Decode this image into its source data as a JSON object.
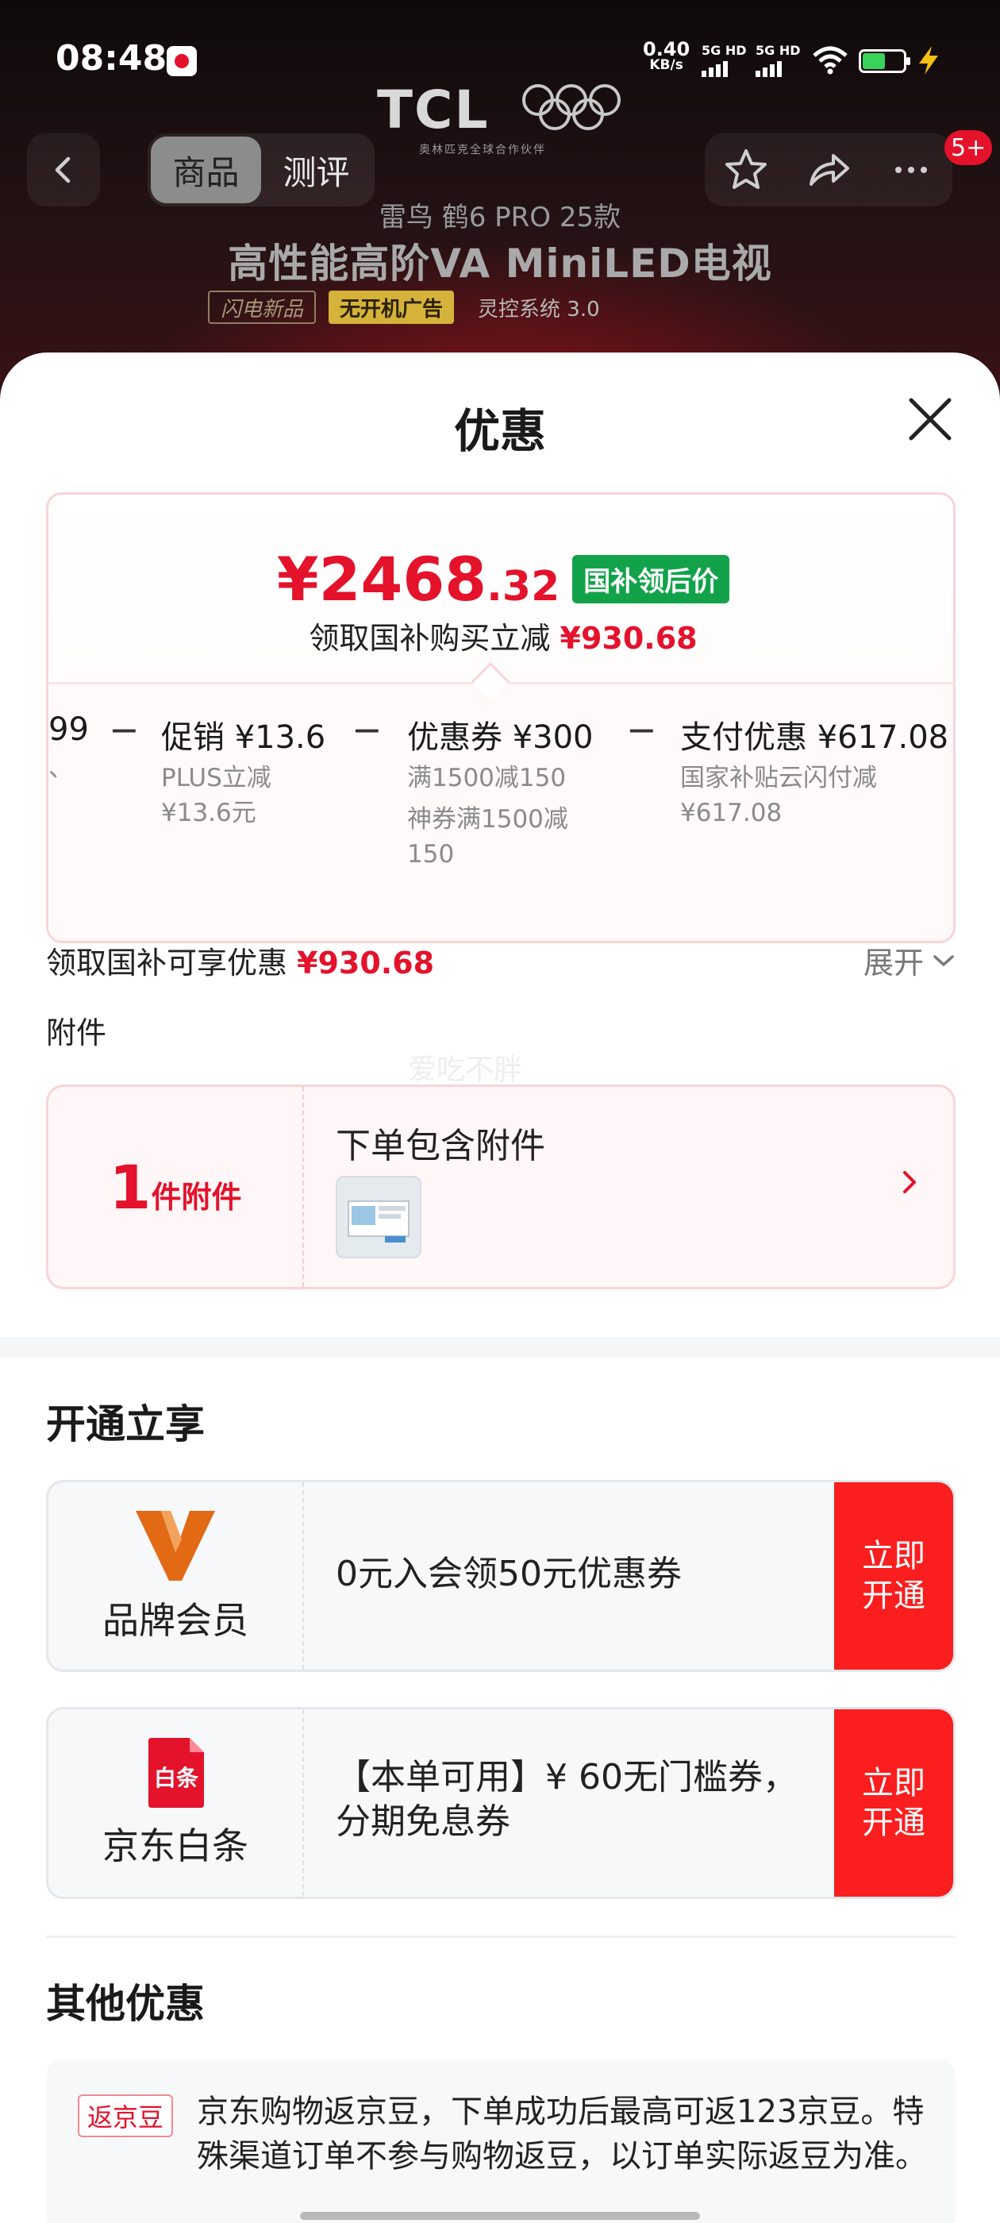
{
  "status_bar": {
    "time": "08:48",
    "net_speed_value": "0.40",
    "net_speed_unit": "KB/s",
    "sim1": "5G HD",
    "sim2": "5G HD",
    "battery_level": 0.55
  },
  "header": {
    "brand": "TCL",
    "brand_subtitle": "奥林匹克全球合作伙伴",
    "tabs": [
      {
        "label": "商品",
        "active": true
      },
      {
        "label": "测评",
        "active": false
      }
    ],
    "message_badge": "5+",
    "icons": [
      "back-icon",
      "star-icon",
      "share-icon",
      "more-icon"
    ]
  },
  "product_banner": {
    "subtitle": "雷鸟 鹤6 PRO 25款",
    "title": "高性能高阶VA MiniLED电视",
    "tags": [
      "闪电新品",
      "无开机广告",
      "灵控系统 3.0"
    ]
  },
  "sheet": {
    "title": "优惠",
    "price": {
      "currency": "¥",
      "integer": "2468",
      "decimal": ".32",
      "tag": "国补领后价",
      "subtitle_prefix": "领取国补购买立减",
      "subtitle_amount": "¥930.68"
    },
    "breakdown": [
      {
        "head": "99",
        "lines": [
          "、"
        ]
      },
      {
        "head": "促销 ¥13.6",
        "lines": [
          "PLUS立减",
          "¥13.6元"
        ]
      },
      {
        "head": "优惠券 ¥300",
        "lines": [
          "满1500减150"
        ],
        "lines2": [
          "神券满1500减",
          "150"
        ]
      },
      {
        "head": "支付优惠 ¥617.08",
        "lines": [
          "国家补贴云闪付减",
          "¥617.08"
        ]
      }
    ],
    "minus_sign": "−",
    "discount": {
      "label": "领取国补可享优惠",
      "amount": "¥930.68",
      "expand": "展开"
    },
    "accessory": {
      "section": "附件",
      "watermark": "爱吃不胖",
      "count": "1",
      "unit": "件附件",
      "text": "下单包含附件"
    },
    "open_section": {
      "title": "开通立享",
      "cards": [
        {
          "name": "品牌会员",
          "text_line1": "0元入会领50元优惠券",
          "text_line2": "",
          "button_line1": "立即",
          "button_line2": "开通",
          "icon": "brand-member-icon"
        },
        {
          "name": "京东白条",
          "text_line1": "【本单可用】¥ 60无门槛券，",
          "text_line2": "分期免息券",
          "button_line1": "立即",
          "button_line2": "开通",
          "icon": "baitiao-icon",
          "icon_text": "白条"
        }
      ]
    },
    "other_section": {
      "title": "其他优惠",
      "tag": "返京豆",
      "text": "京东购物返京豆，下单成功后最高可返123京豆。特殊渠道订单不参与购物返豆，以订单实际返豆为准。"
    }
  },
  "colors": {
    "accent_red": "#e4122b",
    "green_tag": "#12a34a",
    "button_red": "#fa1e1e",
    "member_orange": "#e36a15"
  }
}
